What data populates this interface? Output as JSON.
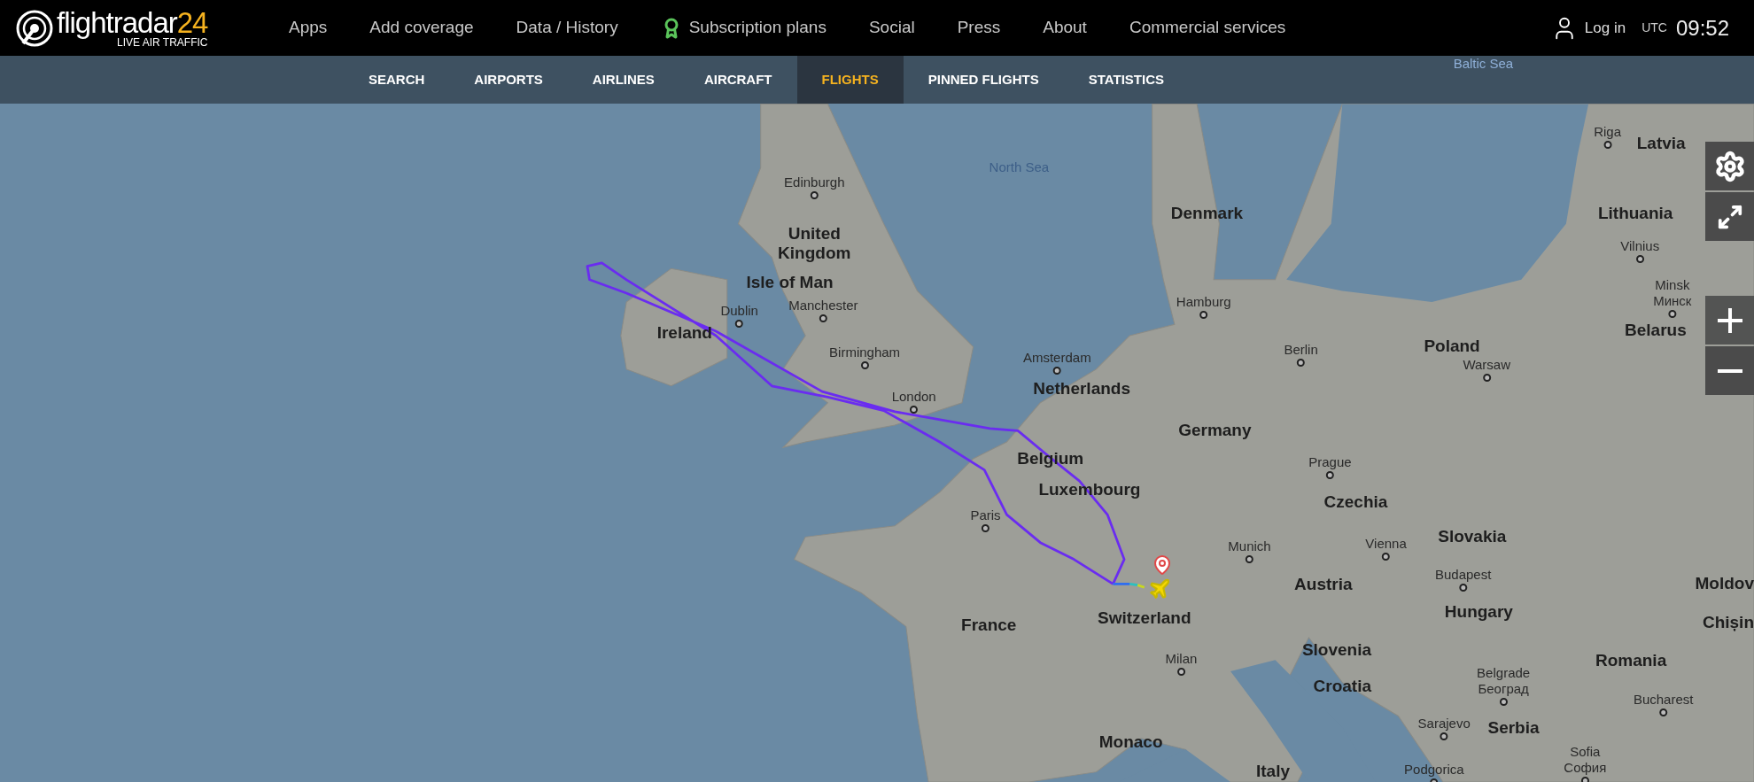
{
  "header": {
    "logo": {
      "name": "flightradar",
      "number": "24",
      "tagline": "LIVE AIR TRAFFIC"
    },
    "menu": [
      {
        "label": "Apps",
        "kind": "link"
      },
      {
        "label": "Add coverage",
        "kind": "link"
      },
      {
        "label": "Data / History",
        "kind": "link"
      },
      {
        "label": "Subscription plans",
        "kind": "subscription"
      },
      {
        "label": "Social",
        "kind": "link"
      },
      {
        "label": "Press",
        "kind": "link"
      },
      {
        "label": "About",
        "kind": "link"
      },
      {
        "label": "Commercial services",
        "kind": "link"
      }
    ],
    "login": "Log in",
    "timezone": "UTC",
    "time": "09:52"
  },
  "subnav": [
    {
      "label": "SEARCH",
      "selected": false
    },
    {
      "label": "AIRPORTS",
      "selected": false
    },
    {
      "label": "AIRLINES",
      "selected": false
    },
    {
      "label": "AIRCRAFT",
      "selected": false
    },
    {
      "label": "FLIGHTS",
      "selected": true
    },
    {
      "label": "PINNED FLIGHTS",
      "selected": false
    },
    {
      "label": "STATISTICS",
      "selected": false
    }
  ],
  "map": {
    "labels": [
      {
        "text": "Baltic Sea",
        "kind": "sea"
      },
      {
        "text": "Riga",
        "kind": "city"
      },
      {
        "text": "Latvia",
        "kind": "country"
      },
      {
        "text": "North Sea",
        "kind": "sea"
      },
      {
        "text": "Edinburgh",
        "kind": "city"
      },
      {
        "text": "Denmark",
        "kind": "country"
      },
      {
        "text": "Lithuania",
        "kind": "country"
      },
      {
        "text": "United Kingdom",
        "kind": "country"
      },
      {
        "text": "Vilnius",
        "kind": "city"
      },
      {
        "text": "Isle of Man",
        "kind": "country"
      },
      {
        "text": "Minsk",
        "native": "Минск",
        "kind": "city"
      },
      {
        "text": "Dublin",
        "kind": "city"
      },
      {
        "text": "Manchester",
        "kind": "city"
      },
      {
        "text": "Hamburg",
        "kind": "city"
      },
      {
        "text": "Ireland",
        "kind": "country"
      },
      {
        "text": "Birmingham",
        "kind": "city"
      },
      {
        "text": "Amsterdam",
        "kind": "city"
      },
      {
        "text": "Berlin",
        "kind": "city"
      },
      {
        "text": "Poland",
        "kind": "country"
      },
      {
        "text": "Warsaw",
        "kind": "city"
      },
      {
        "text": "Belarus",
        "kind": "country"
      },
      {
        "text": "London",
        "kind": "city"
      },
      {
        "text": "Netherlands",
        "kind": "country"
      },
      {
        "text": "Germany",
        "kind": "country"
      },
      {
        "text": "Belgium",
        "kind": "country"
      },
      {
        "text": "Prague",
        "kind": "city"
      },
      {
        "text": "Luxembourg",
        "kind": "country"
      },
      {
        "text": "Czechia",
        "kind": "country"
      },
      {
        "text": "Paris",
        "kind": "city"
      },
      {
        "text": "Munich",
        "kind": "city"
      },
      {
        "text": "Vienna",
        "kind": "city"
      },
      {
        "text": "Slovakia",
        "kind": "country"
      },
      {
        "text": "Austria",
        "kind": "country"
      },
      {
        "text": "Budapest",
        "kind": "city"
      },
      {
        "text": "Moldov",
        "kind": "country"
      },
      {
        "text": "France",
        "kind": "country"
      },
      {
        "text": "Switzerland",
        "kind": "country"
      },
      {
        "text": "Hungary",
        "kind": "country"
      },
      {
        "text": "Chișin",
        "kind": "country"
      },
      {
        "text": "Milan",
        "kind": "city"
      },
      {
        "text": "Slovenia",
        "kind": "country"
      },
      {
        "text": "Romania",
        "kind": "country"
      },
      {
        "text": "Croatia",
        "kind": "country"
      },
      {
        "text": "Belgrade",
        "native": "Београд",
        "kind": "city"
      },
      {
        "text": "Bucharest",
        "kind": "city"
      },
      {
        "text": "Sarajevo",
        "kind": "city"
      },
      {
        "text": "Serbia",
        "kind": "country"
      },
      {
        "text": "Monaco",
        "kind": "country"
      },
      {
        "text": "Italy",
        "kind": "country"
      },
      {
        "text": "Podgorica",
        "kind": "city"
      },
      {
        "text": "Sofia",
        "native": "София",
        "kind": "city"
      }
    ]
  }
}
